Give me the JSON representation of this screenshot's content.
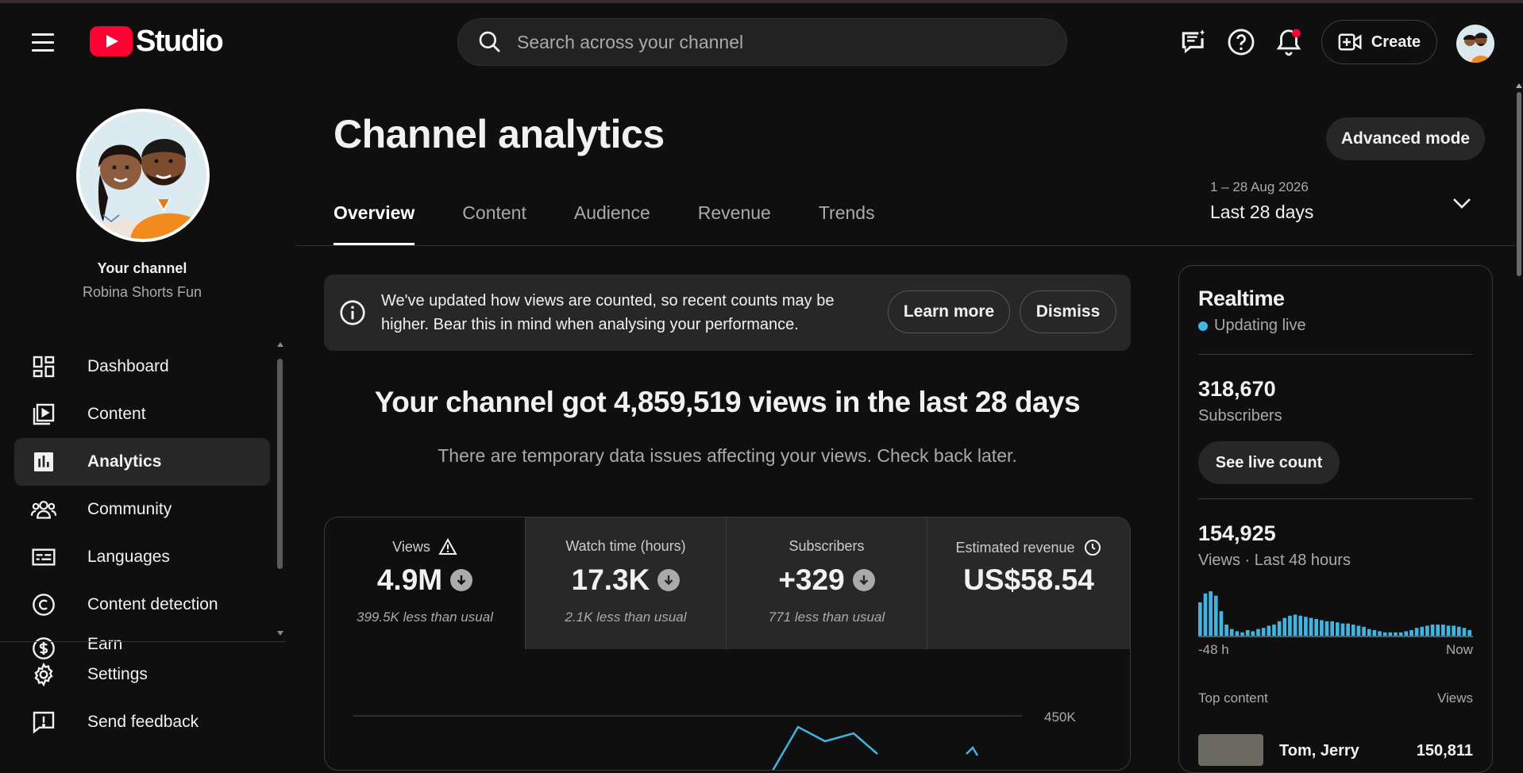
{
  "app": {
    "logo_text": "Studio"
  },
  "search": {
    "placeholder": "Search across your channel"
  },
  "header": {
    "create_label": "Create"
  },
  "sidebar": {
    "your_channel": "Your channel",
    "channel_name": "Robina Shorts Fun",
    "items": [
      {
        "label": "Dashboard",
        "icon": "dashboard-icon"
      },
      {
        "label": "Content",
        "icon": "content-icon"
      },
      {
        "label": "Analytics",
        "icon": "analytics-icon",
        "active": true
      },
      {
        "label": "Community",
        "icon": "community-icon"
      },
      {
        "label": "Languages",
        "icon": "languages-icon"
      },
      {
        "label": "Content detection",
        "icon": "copyright-icon"
      },
      {
        "label": "Earn",
        "icon": "earn-icon"
      }
    ],
    "bottom": [
      {
        "label": "Settings",
        "icon": "gear-icon"
      },
      {
        "label": "Send feedback",
        "icon": "feedback-icon"
      }
    ]
  },
  "main": {
    "title": "Channel analytics",
    "advanced_mode": "Advanced mode",
    "tabs": [
      "Overview",
      "Content",
      "Audience",
      "Revenue",
      "Trends"
    ],
    "date_range": {
      "dates": "1 – 28 Aug 2026",
      "label": "Last 28 days"
    },
    "banner": {
      "text": "We've updated how views are counted, so recent counts may be higher. Bear this in mind when analysing your performance.",
      "learn_more": "Learn more",
      "dismiss": "Dismiss"
    },
    "headline": "Your channel got 4,859,519 views in the last 28 days",
    "subline": "There are temporary data issues affecting your views. Check back later.",
    "metrics": [
      {
        "label": "Views",
        "value": "4.9M",
        "note": "399.5K less than usual",
        "icon": "warning-icon",
        "trend": "down"
      },
      {
        "label": "Watch time (hours)",
        "value": "17.3K",
        "note": "2.1K less than usual",
        "trend": "down"
      },
      {
        "label": "Subscribers",
        "value": "+329",
        "note": "771 less than usual",
        "trend": "down"
      },
      {
        "label": "Estimated revenue",
        "value": "US$58.54",
        "note": "",
        "icon": "clock-icon"
      }
    ],
    "chart_tick": "450K"
  },
  "realtime": {
    "title": "Realtime",
    "live": "Updating live",
    "subscribers": "318,670",
    "subscribers_label": "Subscribers",
    "see_live": "See live count",
    "views": "154,925",
    "views_label": "Views · Last 48 hours",
    "axis_start": "-48 h",
    "axis_end": "Now",
    "top_content": "Top content",
    "views_col": "Views",
    "top_item": {
      "title": "Tom, Jerry",
      "views": "150,811"
    }
  },
  "colors": {
    "accent": "#41b4e0",
    "brand": "#ff0033",
    "bg": "#0f0f0f"
  },
  "chart_data": [
    {
      "type": "bar",
      "title": "Views · Last 48 hours",
      "xlabel": "",
      "ylabel": "",
      "x_range": [
        "-48 h",
        "Now"
      ],
      "values": [
        30,
        38,
        40,
        36,
        22,
        10,
        6,
        4,
        3,
        5,
        4,
        6,
        7,
        9,
        10,
        13,
        16,
        18,
        19,
        18,
        17,
        16,
        15,
        14,
        13,
        13,
        12,
        11,
        11,
        10,
        9,
        8,
        6,
        5,
        4,
        3,
        3,
        3,
        3,
        4,
        5,
        7,
        8,
        9,
        10,
        10,
        10,
        9,
        9,
        8,
        7,
        5
      ]
    },
    {
      "type": "line",
      "title": "Views",
      "ytick": "450K"
    }
  ]
}
